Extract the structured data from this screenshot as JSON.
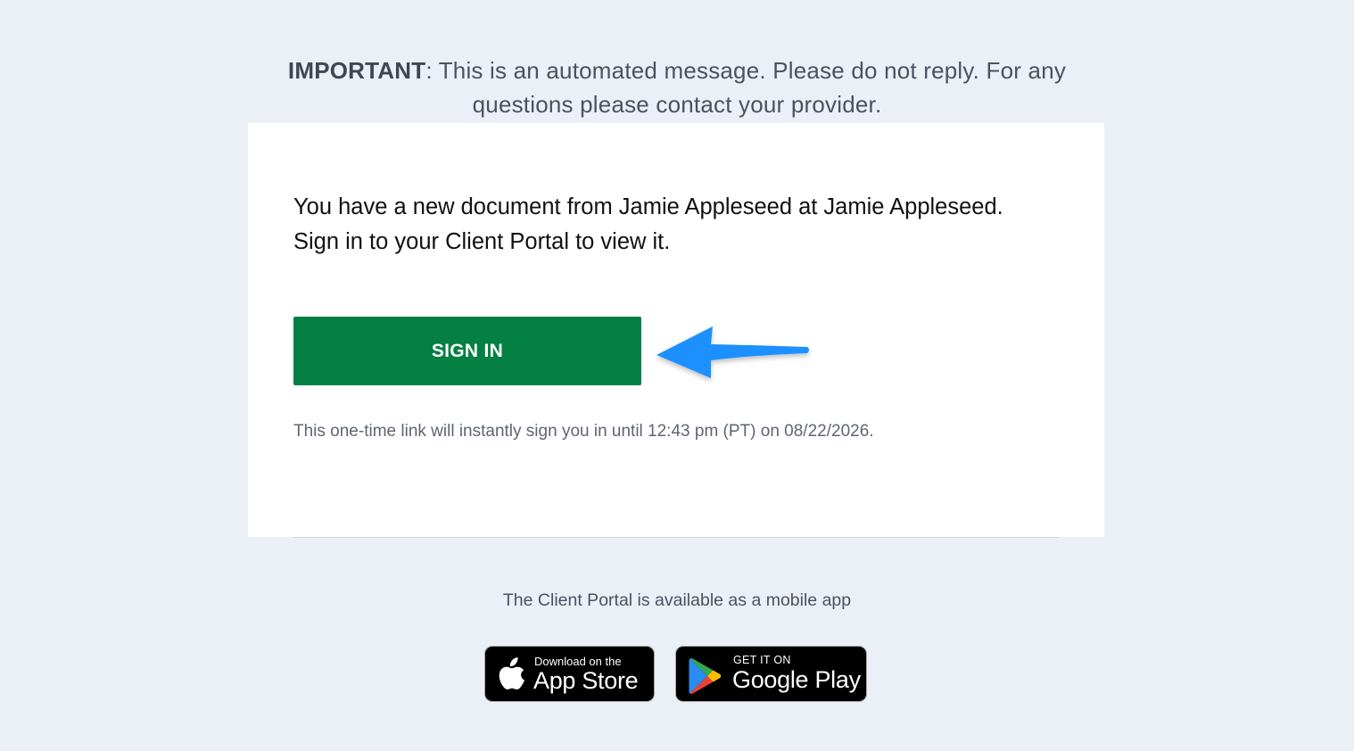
{
  "notice": {
    "bold": "IMPORTANT",
    "text": ": This is an automated message. Please do not reply. For any questions please contact your provider."
  },
  "card": {
    "message_line1": "You have a new document from Jamie Appleseed at Jamie Appleseed.",
    "message_line2": "Sign in to your Client Portal to view it.",
    "signin_label": "SIGN IN",
    "link_note": "This one-time link will instantly sign you in until 12:43 pm (PT) on 08/22/2026."
  },
  "footer": {
    "mobile_note": "The Client Portal is available as a mobile app",
    "appstore": {
      "small": "Download on the",
      "big": "App Store",
      "icon": "apple-icon"
    },
    "googleplay": {
      "small": "GET IT ON",
      "big": "Google Play",
      "icon": "google-play-icon"
    }
  },
  "colors": {
    "background": "#ebeff6",
    "button": "#048043",
    "arrow": "#1e90ff",
    "card": "#ffffff"
  }
}
